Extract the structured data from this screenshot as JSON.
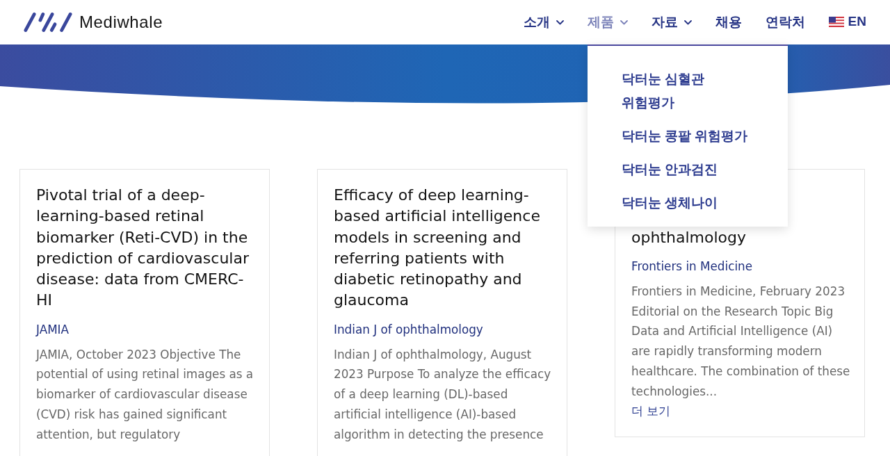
{
  "header": {
    "logo_text": "Mediwhale",
    "nav": [
      {
        "label": "소개",
        "kind": "dropdown",
        "open": false
      },
      {
        "label": "제품",
        "kind": "dropdown",
        "open": true,
        "menu": [
          "닥터눈 심혈관 위험평가",
          "닥터눈 콩팥 위험평가",
          "닥터눈 안과검진",
          "닥터눈 생체나이"
        ]
      },
      {
        "label": "자료",
        "kind": "dropdown",
        "open": false
      },
      {
        "label": "채용",
        "kind": "link",
        "open": false
      },
      {
        "label": "연락처",
        "kind": "link",
        "open": false
      }
    ],
    "language": {
      "label": "EN",
      "selected": false
    }
  },
  "cards": [
    {
      "title": "Pivotal trial of a deep-learning-based retinal biomarker (Reti-CVD) in the prediction of cardiovascular disease: data from CMERC-HI",
      "journal": "JAMIA",
      "summary": "JAMIA, October 2023 Objective The potential of using retinal images as a biomarker of cardiovascular disease (CVD) risk has gained significant attention, but regulatory"
    },
    {
      "title": "Efficacy of deep learning-based artificial intelligence models in screening and referring patients with diabetic retinopathy and glaucoma",
      "journal": "Indian J of ophthalmology",
      "summary": "Indian J of ophthalmology, August 2023 Purpose To analyze the efficacy of a deep learning (DL)-based artificial intelligence (AI)-based algorithm in detecting the presence"
    },
    {
      "title": "ophthalmology",
      "journal": "Frontiers in Medicine",
      "summary": "Frontiers in Medicine, February 2023 Editorial on the Research Topic Big Data and Artificial Intelligence (AI) are rapidly transforming modern healthcare. The combination of these technologies...",
      "more_link": "더 보기"
    }
  ]
}
